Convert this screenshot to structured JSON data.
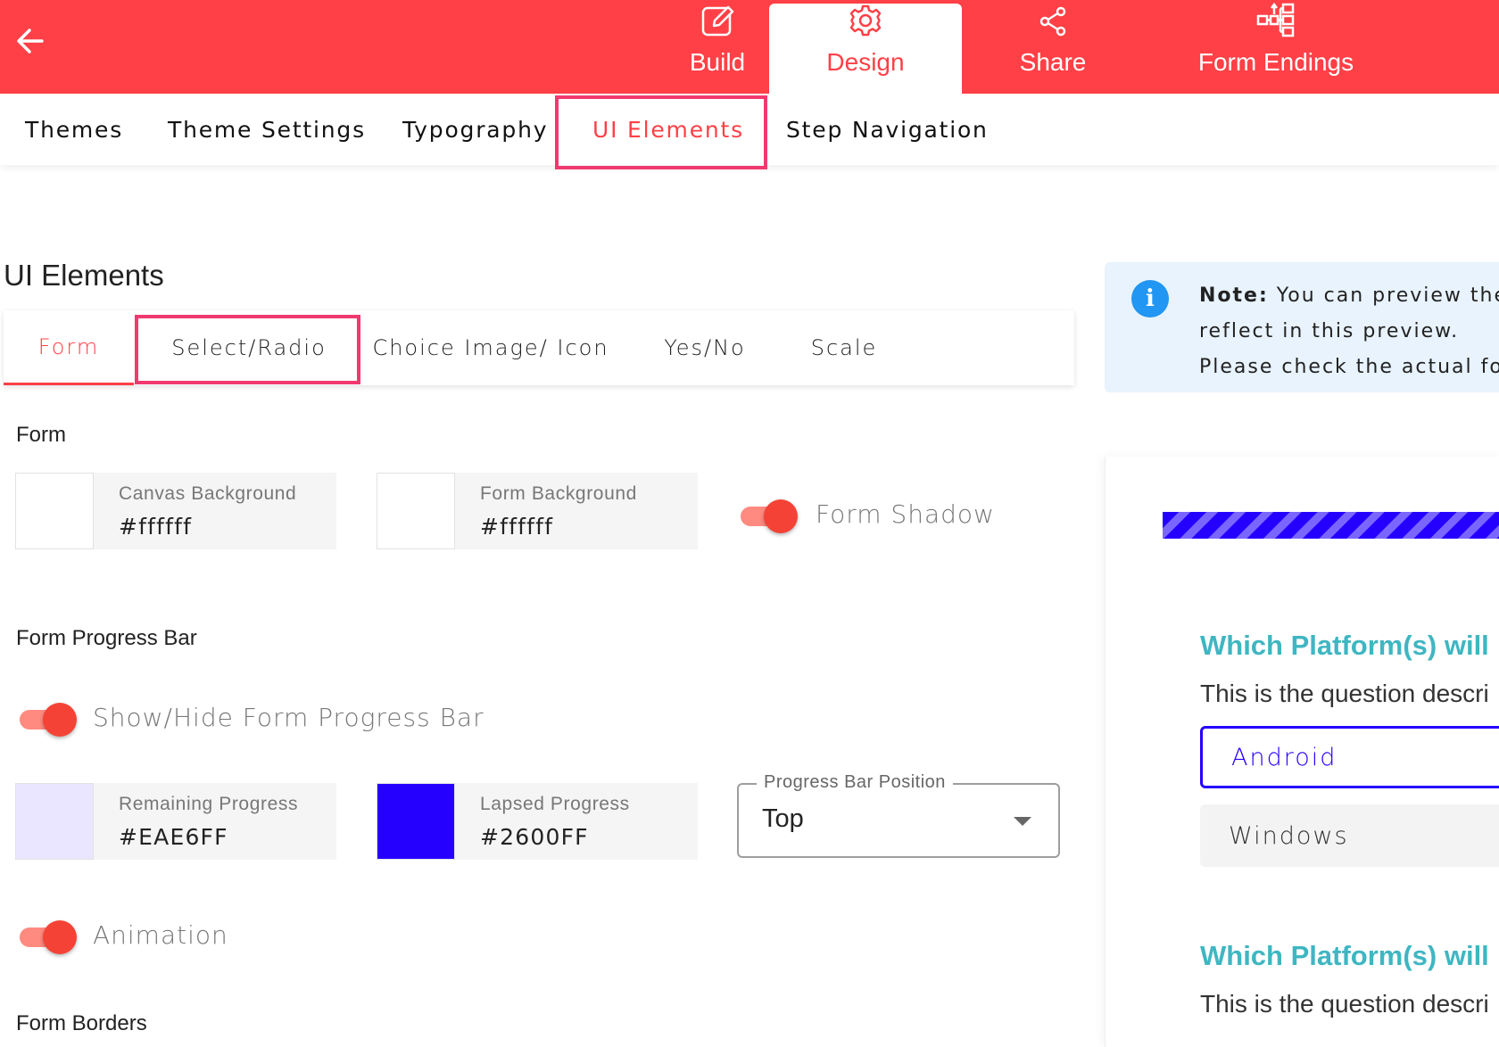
{
  "topbar": {
    "tabs": [
      {
        "label": "Build",
        "icon": "edit-icon"
      },
      {
        "label": "Design",
        "icon": "gear-icon"
      },
      {
        "label": "Share",
        "icon": "share-icon"
      },
      {
        "label": "Form Endings",
        "icon": "flow-icon"
      }
    ],
    "active_tab": "Design",
    "colors": {
      "brand": "#ff4046"
    }
  },
  "subnav": {
    "tabs": [
      "Themes",
      "Theme Settings",
      "Typography",
      "UI Elements",
      "Step Navigation"
    ],
    "active": "UI Elements"
  },
  "page": {
    "title": "UI Elements",
    "inner_tabs": [
      "Form",
      "Select/Radio",
      "Choice Image/ Icon",
      "Yes/No",
      "Scale"
    ],
    "active_inner_tab": "Form"
  },
  "form_section": {
    "label": "Form",
    "canvas_background": {
      "label": "Canvas Background",
      "value": "#ffffff"
    },
    "form_background": {
      "label": "Form Background",
      "value": "#ffffff"
    },
    "form_shadow": {
      "label": "Form Shadow",
      "on": true
    }
  },
  "progress_section": {
    "label": "Form Progress Bar",
    "show_hide": {
      "label": "Show/Hide Form Progress Bar",
      "on": true
    },
    "remaining": {
      "label": "Remaining Progress",
      "value": "#EAE6FF"
    },
    "lapsed": {
      "label": "Lapsed Progress",
      "value": "#2600FF"
    },
    "position": {
      "label": "Progress Bar Position",
      "value": "Top"
    },
    "animation": {
      "label": "Animation",
      "on": true
    }
  },
  "borders_section": {
    "label": "Form Borders"
  },
  "note": {
    "bold": "Note:",
    "line1": " You can preview the",
    "line2": "reflect in this preview.",
    "line3": "Please check the actual fo"
  },
  "preview": {
    "questions": [
      {
        "title": "Which Platform(s) will",
        "description": "This is the question descri"
      },
      {
        "title": "Which Platform(s) will",
        "description": "This is the question descri"
      }
    ],
    "choices": [
      "Android",
      "Windows"
    ],
    "colors": {
      "question": "#3fb6c2",
      "accent": "#2600ff"
    }
  }
}
